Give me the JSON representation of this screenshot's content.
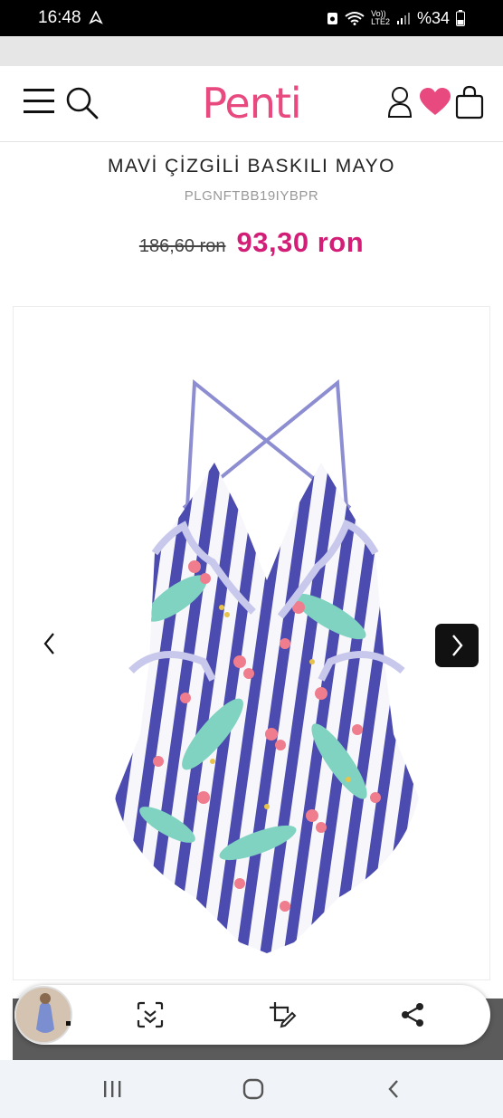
{
  "status_bar": {
    "time": "16:48",
    "network_top": "Vo))",
    "network_bottom": "LTE2",
    "battery": "%34"
  },
  "header": {
    "logo": "Penti",
    "icons": [
      "menu-icon",
      "search-icon",
      "user-icon",
      "heart-icon",
      "bag-icon"
    ]
  },
  "product": {
    "title": "MAVİ ÇİZGİLİ BASKILI MAYO",
    "code": "PLGNFTBB19IYBPR",
    "old_price": "186,60 ron",
    "new_price": "93,30 ron"
  },
  "gallery": {
    "image": "swimsuit-photo",
    "prev": "chevron-left-icon",
    "next": "chevron-right-icon"
  },
  "floating_bar": {
    "icons": [
      "scan-icon",
      "crop-edit-icon",
      "share-icon"
    ]
  },
  "system_nav": {
    "icons": [
      "recents-icon",
      "home-icon",
      "back-icon"
    ]
  },
  "colors": {
    "brand": "#e84a7f",
    "price": "#d31e78"
  }
}
